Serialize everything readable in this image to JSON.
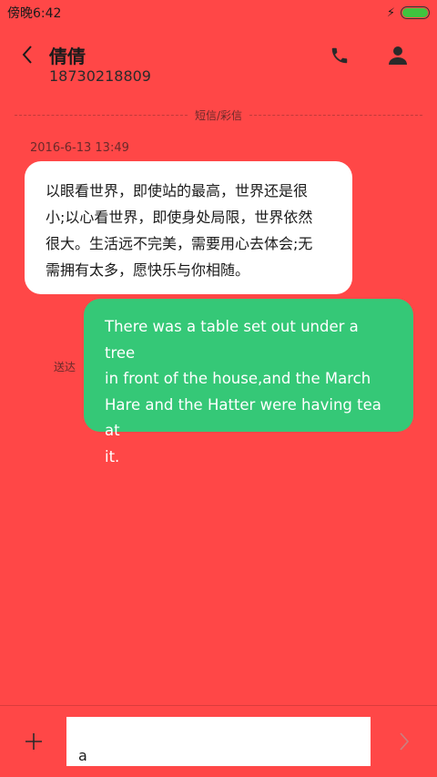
{
  "status_bar": {
    "time": "傍晚6:42",
    "charging_icon": "bolt-icon",
    "battery_icon": "battery-icon",
    "battery_level": 1.0,
    "battery_color": "#3fc43f"
  },
  "header": {
    "back_icon": "chevron-left-icon",
    "contact_name": "倩倩",
    "contact_number": "18730218809",
    "call_icon": "phone-icon",
    "contact_icon": "person-icon"
  },
  "thread": {
    "section_label": "短信/彩信",
    "messages": [
      {
        "direction": "incoming",
        "timestamp": "2016-6-13 13:49",
        "lines": [
          "以眼看世界，即使站的最高，世界还是很",
          "小;以心看世界，即使身处局限，世界依然",
          "很大。生活远不完美，需要用心去体会;无",
          "需拥有太多，愿快乐与你相随。"
        ],
        "bubble_color": "#FFFFFF"
      },
      {
        "direction": "outgoing",
        "status": "送达",
        "lines": [
          "There was a table set out under a tree",
          "in front of the house,and the March",
          "Hare and the Hatter were having tea at",
          "it."
        ],
        "bubble_color": "#35C877"
      }
    ]
  },
  "composer": {
    "add_icon": "plus-icon",
    "input_value": "a",
    "send_icon": "chevron-right-icon"
  },
  "theme": {
    "background": "#FF4747"
  }
}
